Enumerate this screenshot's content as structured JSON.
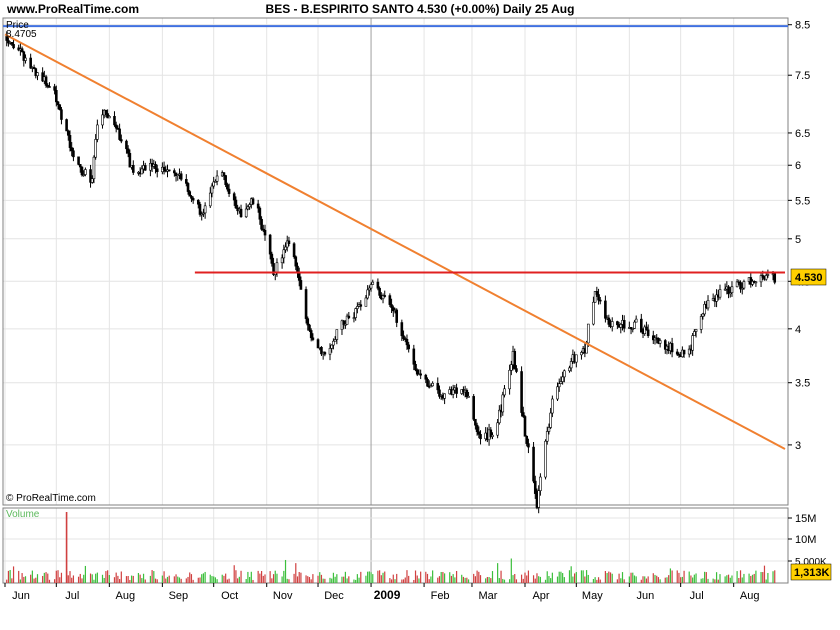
{
  "header": {
    "site": "www.ProRealTime.com",
    "title": "BES - B.ESPIRITO SANTO    4.530 (+0.00%)    Daily  25 Aug"
  },
  "price_panel": {
    "label": "Price",
    "max_value_label": "8.4705",
    "last_price_label": "4.530",
    "copyright": "© ProRealTime.com"
  },
  "volume_panel": {
    "label": "Volume",
    "last_volume_label": "1,313K"
  },
  "colors": {
    "background": "#ffffff",
    "border": "#808080",
    "grid": "#e4e4e4",
    "candle": "#000000",
    "trendline_down": "#f08030",
    "resistance": "#e02020",
    "max_line": "#4070e0",
    "volume_up": "#3cbf3c",
    "volume_down": "#d04040",
    "badge": "#ffd000"
  },
  "chart_data": {
    "type": "candlestick",
    "title": "BES - B.ESPIRITO SANTO",
    "last_price": 4.53,
    "change_pct": 0.0,
    "x_tick_labels": [
      "Jun",
      "Jul",
      "Aug",
      "Sep",
      "Oct",
      "Nov",
      "Dec",
      "2009",
      "Feb",
      "Mar",
      "Apr",
      "May",
      "Jun",
      "Jul",
      "Aug"
    ],
    "y_ticks": [
      3,
      3.5,
      4,
      4.5,
      5,
      5.5,
      6,
      6.5,
      7.5,
      8.5
    ],
    "y_tick_labels": [
      "3",
      "3.5",
      "4",
      "4.5",
      "5",
      "5.5",
      "6",
      "6.5",
      "7.5",
      "8.5"
    ],
    "y_scale": "log",
    "ylim": [
      2.75,
      8.6
    ],
    "max_price": 8.4705,
    "price_path": [
      [
        "2008-06-01",
        8.3
      ],
      [
        "2008-06-15",
        7.7
      ],
      [
        "2008-06-30",
        7.2
      ],
      [
        "2008-07-12",
        6.0
      ],
      [
        "2008-07-22",
        5.8
      ],
      [
        "2008-07-26",
        6.9
      ],
      [
        "2008-08-05",
        6.6
      ],
      [
        "2008-08-15",
        5.9
      ],
      [
        "2008-08-25",
        6.0
      ],
      [
        "2008-09-10",
        5.85
      ],
      [
        "2008-09-25",
        5.3
      ],
      [
        "2008-10-05",
        6.0
      ],
      [
        "2008-10-15",
        5.3
      ],
      [
        "2008-10-25",
        5.5
      ],
      [
        "2008-11-05",
        4.6
      ],
      [
        "2008-11-15",
        5.0
      ],
      [
        "2008-11-25",
        4.0
      ],
      [
        "2008-12-05",
        3.75
      ],
      [
        "2008-12-15",
        4.05
      ],
      [
        "2008-12-25",
        4.2
      ],
      [
        "2009-01-01",
        4.5
      ],
      [
        "2009-01-15",
        4.15
      ],
      [
        "2009-01-28",
        3.6
      ],
      [
        "2009-02-10",
        3.4
      ],
      [
        "2009-02-25",
        3.45
      ],
      [
        "2009-03-05",
        3.05
      ],
      [
        "2009-03-15",
        3.1
      ],
      [
        "2009-03-25",
        3.75
      ],
      [
        "2009-04-01",
        3.1
      ],
      [
        "2009-04-08",
        2.6
      ],
      [
        "2009-04-18",
        3.4
      ],
      [
        "2009-04-28",
        3.7
      ],
      [
        "2009-05-06",
        3.8
      ],
      [
        "2009-05-12",
        4.4
      ],
      [
        "2009-05-20",
        4.05
      ],
      [
        "2009-06-05",
        4.05
      ],
      [
        "2009-06-20",
        3.85
      ],
      [
        "2009-07-05",
        3.75
      ],
      [
        "2009-07-15",
        4.2
      ],
      [
        "2009-07-25",
        4.4
      ],
      [
        "2009-08-05",
        4.45
      ],
      [
        "2009-08-15",
        4.55
      ],
      [
        "2009-08-25",
        4.53
      ]
    ],
    "overlays": [
      {
        "kind": "trendline",
        "from": [
          "2008-06-01",
          8.3
        ],
        "to": [
          "2009-08-31",
          2.97
        ]
      },
      {
        "kind": "horizontal",
        "value": 4.6,
        "from_date": "2008-09-20",
        "to_date": "2009-08-31"
      },
      {
        "kind": "horizontal",
        "value": 8.4705
      }
    ],
    "volume_ticks": [
      "15M",
      "10M",
      "5.000K"
    ],
    "last_volume": "1,313K"
  }
}
